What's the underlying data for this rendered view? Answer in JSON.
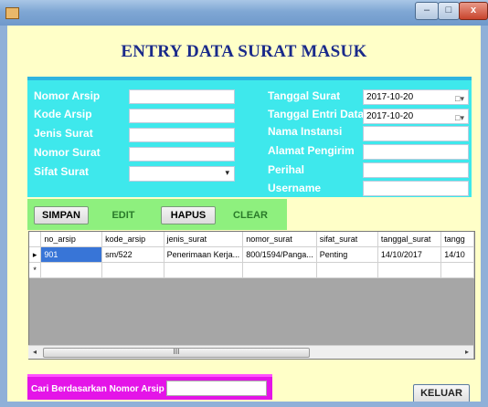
{
  "title": "ENTRY DATA SURAT MASUK",
  "window": {
    "minimize_symbol": "–",
    "maximize_symbol": "□",
    "close_symbol": "x"
  },
  "form": {
    "left_labels": [
      "Nomor Arsip",
      "Kode Arsip",
      "Jenis Surat",
      "Nomor Surat",
      "Sifat Surat"
    ],
    "right_labels": [
      "Tanggal Surat",
      "Tanggal Entri Data",
      "Nama Instansi",
      "Alamat Pengirim",
      "Perihal",
      "Username"
    ],
    "tanggal_surat": "2017-10-20",
    "tanggal_entri": "2017-10-20",
    "calendar_icon": "calendar-dropdown-icon",
    "dropdown_arrow": "▾"
  },
  "buttons": {
    "simpan": "SIMPAN",
    "edit": "EDIT",
    "hapus": "HAPUS",
    "clear": "CLEAR",
    "keluar": "KELUAR"
  },
  "grid": {
    "columns": [
      "no_arsip",
      "kode_arsip",
      "jenis_surat",
      "nomor_surat",
      "sifat_surat",
      "tanggal_surat",
      "tangg"
    ],
    "rows": [
      [
        "901",
        "sm/522",
        "Penerimaan Kerja...",
        "800/1594/Panga...",
        "Penting",
        "14/10/2017",
        "14/10"
      ]
    ],
    "current_row_marker": "▸",
    "new_row_marker": "*",
    "scroll_left": "◂",
    "scroll_right": "▸",
    "scroll_thumb_grip": "III"
  },
  "search": {
    "label": "Cari Berdasarkan Nomor Arsip",
    "value": ""
  },
  "colors": {
    "form_panel": "#3ee8ec",
    "button_panel": "#8ef07e",
    "search_panel": "#e414e8",
    "background": "#ffffc8",
    "title": "#1a2a8a"
  }
}
